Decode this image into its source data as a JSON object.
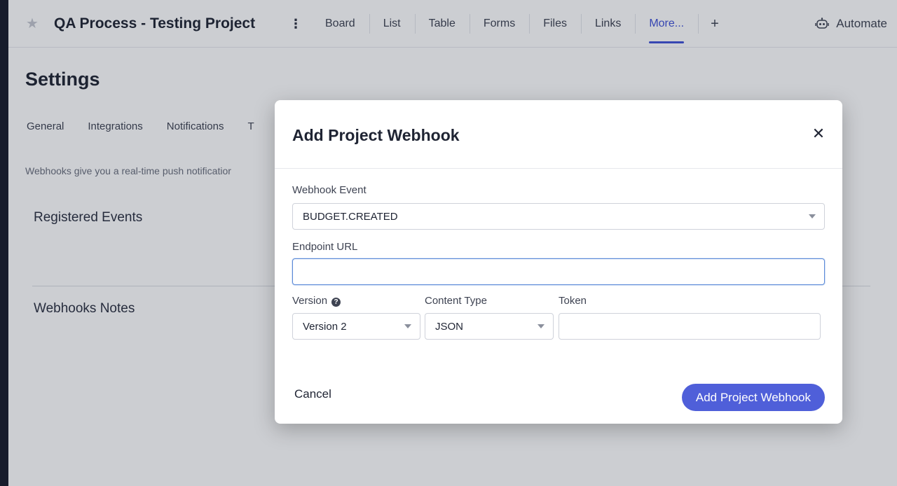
{
  "header": {
    "project_title": "QA Process - Testing Project",
    "tabs": [
      {
        "label": "Board"
      },
      {
        "label": "List"
      },
      {
        "label": "Table"
      },
      {
        "label": "Forms"
      },
      {
        "label": "Files"
      },
      {
        "label": "Links"
      },
      {
        "label": "More..."
      },
      {
        "label": "+"
      }
    ],
    "active_tab": "More...",
    "automate_label": "Automate"
  },
  "settings": {
    "title": "Settings",
    "tabs": [
      "General",
      "Integrations",
      "Notifications",
      "T"
    ],
    "description": "Webhooks give you a real-time push notificatior",
    "sections": [
      "Registered Events",
      "Webhooks Notes"
    ]
  },
  "modal": {
    "title": "Add Project Webhook",
    "webhook_event_label": "Webhook Event",
    "webhook_event_value": "BUDGET.CREATED",
    "endpoint_label": "Endpoint URL",
    "endpoint_value": "",
    "version_label": "Version",
    "version_value": "Version 2",
    "content_type_label": "Content Type",
    "content_type_value": "JSON",
    "token_label": "Token",
    "token_value": "",
    "cancel_label": "Cancel",
    "submit_label": "Add Project Webhook"
  },
  "colors": {
    "accent": "#4f5fd9",
    "active_tab": "#3f51d6",
    "focus_border": "#5b8ad8"
  },
  "icons": [
    "star-icon",
    "kebab-menu-icon",
    "plus-icon",
    "robot-icon",
    "close-icon",
    "help-icon",
    "chevron-down-icon"
  ]
}
